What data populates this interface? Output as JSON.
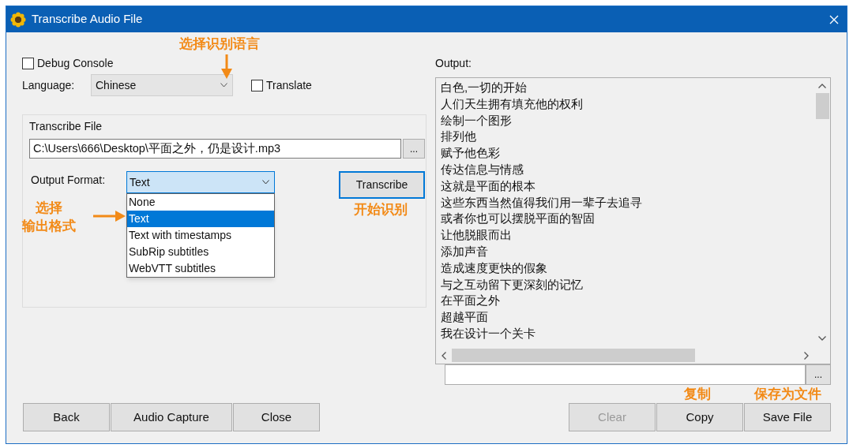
{
  "window": {
    "title": "Transcribe Audio File"
  },
  "debug_console": {
    "label": "Debug Console",
    "checked": false
  },
  "language": {
    "label": "Language:",
    "value": "Chinese"
  },
  "translate": {
    "label": "Translate",
    "checked": false
  },
  "transcribe_file": {
    "title": "Transcribe File",
    "path": "C:\\Users\\666\\Desktop\\平面之外，仍是设计.mp3",
    "browse": "..."
  },
  "output_format": {
    "label": "Output Format:",
    "value": "Text",
    "expanded": true,
    "options": [
      {
        "label": "None",
        "selected": false
      },
      {
        "label": "Text",
        "selected": true
      },
      {
        "label": "Text with timestamps",
        "selected": false
      },
      {
        "label": "SubRip subtitles",
        "selected": false
      },
      {
        "label": "WebVTT subtitles",
        "selected": false
      }
    ]
  },
  "transcribe_button": "Transcribe",
  "output": {
    "label": "Output:",
    "lines": [
      "白色,一切的开始",
      "人们天生拥有填充他的权利",
      "绘制一个图形",
      "排列他",
      "赋予他色彩",
      "传达信息与情感",
      "这就是平面的根本",
      "这些东西当然值得我们用一辈子去追寻",
      "或者你也可以摆脱平面的智固",
      "让他脱眼而出",
      "添加声音",
      "造成速度更快的假象",
      "与之互动留下更深刻的记忆",
      "在平面之外",
      "超越平面",
      "我在设计一个关卡"
    ],
    "browse": "..."
  },
  "buttons_left": [
    {
      "label": "Back",
      "disabled": false
    },
    {
      "label": "Audio Capture",
      "disabled": false
    },
    {
      "label": "Close",
      "disabled": false
    }
  ],
  "buttons_right": [
    {
      "label": "Clear",
      "disabled": true
    },
    {
      "label": "Copy",
      "disabled": false
    },
    {
      "label": "Save File",
      "disabled": false
    }
  ],
  "annotations": [
    {
      "kind": "callout",
      "lines": [
        "选择识别语言"
      ]
    },
    {
      "kind": "down-arrow"
    },
    {
      "kind": "callout",
      "lines": [
        "选择",
        "输出格式"
      ]
    },
    {
      "kind": "right-arrow"
    },
    {
      "kind": "callout",
      "lines": [
        "开始识别"
      ]
    },
    {
      "kind": "callout",
      "lines": [
        "复制"
      ]
    },
    {
      "kind": "callout",
      "lines": [
        "保存为文件"
      ]
    }
  ]
}
